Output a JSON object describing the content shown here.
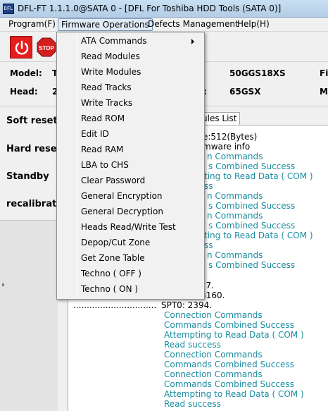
{
  "window": {
    "title": "DFL-FT 1.1.1.0@SATA 0 - [DFL For Toshiba HDD Tools (SATA 0)]",
    "icon": "app-icon"
  },
  "menubar": {
    "items": [
      {
        "label": "Program(F)"
      },
      {
        "label": "Firmware Operations"
      },
      {
        "label": "Defects Management"
      },
      {
        "label": "Help(H)"
      }
    ]
  },
  "toolbar": {
    "power_icon": "power-icon",
    "stop_icon": "stop-sign-icon",
    "stop_label": "STOP"
  },
  "info": {
    "model_label": "Model:",
    "model_value_partial": "T",
    "head_label": "Head:",
    "head_value_partial": "2",
    "field1_value": "50GGS18XS",
    "field2_colon": ":",
    "field2_value": "65GSX",
    "right_label1_partial": "Fi",
    "right_label2_partial": "M"
  },
  "left_panel": {
    "items": [
      {
        "label": "Soft reset"
      },
      {
        "label": "Hard reset"
      },
      {
        "label": "Standby"
      },
      {
        "label": "recalibratio"
      }
    ]
  },
  "tabs": {
    "active_label": "ules List"
  },
  "log": {
    "lines": [
      {
        "text": "e:512(Bytes)",
        "color": "#000000"
      },
      {
        "text": "mware info",
        "color": "#000000"
      },
      {
        "text": "n Commands",
        "color": "#1a8ca0"
      },
      {
        "text": "s Combined Success",
        "color": "#1a8ca0"
      },
      {
        "text": "ting to Read Data ( COM )",
        "color": "#1a8ca0"
      },
      {
        "text": "ss",
        "color": "#1a8ca0"
      },
      {
        "text": "n Commands",
        "color": "#1a8ca0"
      },
      {
        "text": "s Combined Success",
        "color": "#1a8ca0"
      },
      {
        "text": "n Commands",
        "color": "#1a8ca0"
      },
      {
        "text": "s Combined Success",
        "color": "#1a8ca0"
      },
      {
        "text": "ting to Read Data ( COM )",
        "color": "#1a8ca0"
      },
      {
        "text": "ss",
        "color": "#1a8ca0"
      },
      {
        "text": "n Commands",
        "color": "#1a8ca0"
      },
      {
        "text": "s Combined Success",
        "color": "#1a8ca0"
      }
    ],
    "partial_numbers": [
      {
        "text": "73727."
      },
      {
        "text": ": 173160."
      }
    ],
    "spt_line": {
      "dots": "...............................",
      "text": "SPT0: 2394."
    },
    "bottom_lines": [
      {
        "text": "Connection Commands",
        "color": "#1a8ca0"
      },
      {
        "text": "Commands Combined Success",
        "color": "#1a8ca0"
      },
      {
        "text": "Attempting to Read Data ( COM )",
        "color": "#1a8ca0"
      },
      {
        "text": "Read success",
        "color": "#1a8ca0"
      },
      {
        "text": "Connection Commands",
        "color": "#1a8ca0"
      },
      {
        "text": "Commands Combined Success",
        "color": "#1a8ca0"
      },
      {
        "text": "Connection Commands",
        "color": "#1a8ca0"
      },
      {
        "text": "Commands Combined Success",
        "color": "#1a8ca0"
      },
      {
        "text": "Attempting to Read Data ( COM )",
        "color": "#1a8ca0"
      },
      {
        "text": "Read success",
        "color": "#1a8ca0"
      }
    ]
  },
  "dropdown": {
    "items": [
      {
        "label": "ATA Commands",
        "submenu": true
      },
      {
        "label": "Read Modules"
      },
      {
        "label": "Write Modules"
      },
      {
        "label": "Read Tracks"
      },
      {
        "label": "Write Tracks"
      },
      {
        "label": "Read ROM"
      },
      {
        "label": "Edit ID"
      },
      {
        "label": "Read RAM"
      },
      {
        "label": "LBA to CHS"
      },
      {
        "label": "Clear Password"
      },
      {
        "label": "General Encryption"
      },
      {
        "label": "General Decryption"
      },
      {
        "label": "Heads Read/Write Test"
      },
      {
        "label": "Depop/Cut Zone"
      },
      {
        "label": "Get Zone Table"
      },
      {
        "label": "Techno ( OFF )"
      },
      {
        "label": "Techno ( ON )"
      }
    ]
  }
}
